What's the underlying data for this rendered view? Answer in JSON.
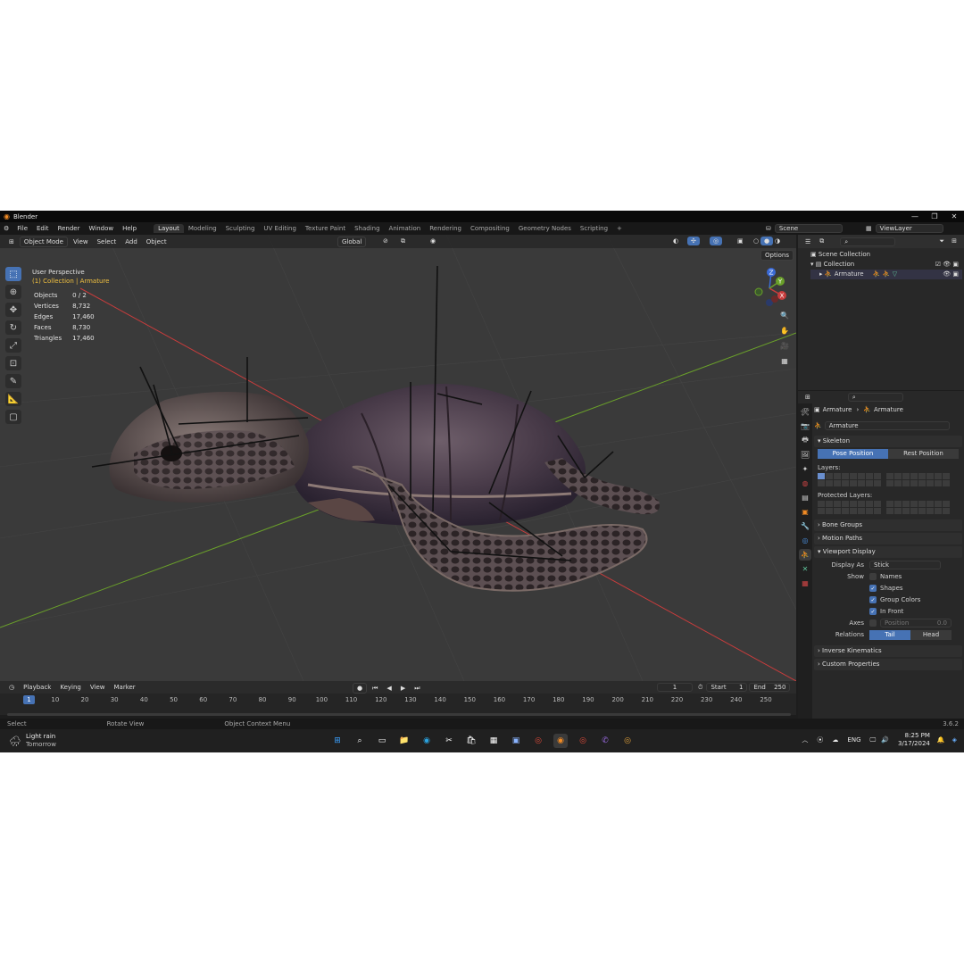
{
  "window": {
    "title": "Blender",
    "controls": [
      "—",
      "❐",
      "✕"
    ]
  },
  "menu": [
    "File",
    "Edit",
    "Render",
    "Window",
    "Help"
  ],
  "workspaces": {
    "tabs": [
      "Layout",
      "Modeling",
      "Sculpting",
      "UV Editing",
      "Texture Paint",
      "Shading",
      "Animation",
      "Rendering",
      "Compositing",
      "Geometry Nodes",
      "Scripting"
    ],
    "active": "Layout",
    "add": "+"
  },
  "scene": {
    "name": "Scene",
    "view_layer": "ViewLayer"
  },
  "viewport": {
    "header": {
      "mode": "Object Mode",
      "menus": [
        "View",
        "Select",
        "Add",
        "Object"
      ],
      "orientation": "Global",
      "options": "Options"
    },
    "view_name": "User Perspective",
    "collection_label": "(1) Collection | Armature",
    "stats": [
      {
        "label": "Objects",
        "value": "0 / 2"
      },
      {
        "label": "Vertices",
        "value": "8,732"
      },
      {
        "label": "Edges",
        "value": "17,460"
      },
      {
        "label": "Faces",
        "value": "8,730"
      },
      {
        "label": "Triangles",
        "value": "17,460"
      }
    ],
    "gizmo": {
      "x": "X",
      "y": "Y",
      "z": "Z"
    }
  },
  "timeline": {
    "menus": [
      "Playback",
      "Keying",
      "View",
      "Marker"
    ],
    "current_frame": "1",
    "start_label": "Start",
    "start": "1",
    "end_label": "End",
    "end": "250",
    "ticks": [
      "1",
      "10",
      "20",
      "30",
      "40",
      "50",
      "60",
      "70",
      "80",
      "90",
      "100",
      "110",
      "120",
      "130",
      "140",
      "150",
      "160",
      "170",
      "180",
      "190",
      "200",
      "210",
      "220",
      "230",
      "240",
      "250"
    ]
  },
  "statusbar": {
    "items": [
      "Select",
      "Rotate View",
      "Object Context Menu"
    ],
    "version": "3.6.2"
  },
  "outliner": {
    "root": "Scene Collection",
    "collection": "Collection",
    "object": "Armature"
  },
  "properties": {
    "breadcrumb": [
      "Armature",
      "Armature"
    ],
    "data_name": "Armature",
    "skeleton": {
      "title": "Skeleton",
      "pose_position": "Pose Position",
      "rest_position": "Rest Position",
      "layers_label": "Layers:",
      "protected_label": "Protected Layers:"
    },
    "collapsed": [
      "Bone Groups",
      "Motion Paths"
    ],
    "viewport_display": {
      "title": "Viewport Display",
      "display_as_label": "Display As",
      "display_as": "Stick",
      "show_label": "Show",
      "names": "Names",
      "shapes": "Shapes",
      "group_colors": "Group Colors",
      "in_front": "In Front",
      "axes_label": "Axes",
      "position": "Position",
      "position_value": "0.0",
      "relations_label": "Relations",
      "tail": "Tail",
      "head": "Head"
    },
    "collapsed_bottom": [
      "Inverse Kinematics",
      "Custom Properties"
    ]
  },
  "taskbar": {
    "weather": "Light rain",
    "weather_sub": "Tomorrow",
    "language": "ENG",
    "time": "8:25 PM",
    "date": "3/17/2024"
  },
  "colors": {
    "accent": "#4672b4",
    "x_axis": "#c83c3c",
    "y_axis": "#6aa02a",
    "z_axis": "#3a6ad6",
    "collection_text": "#f0c040"
  }
}
